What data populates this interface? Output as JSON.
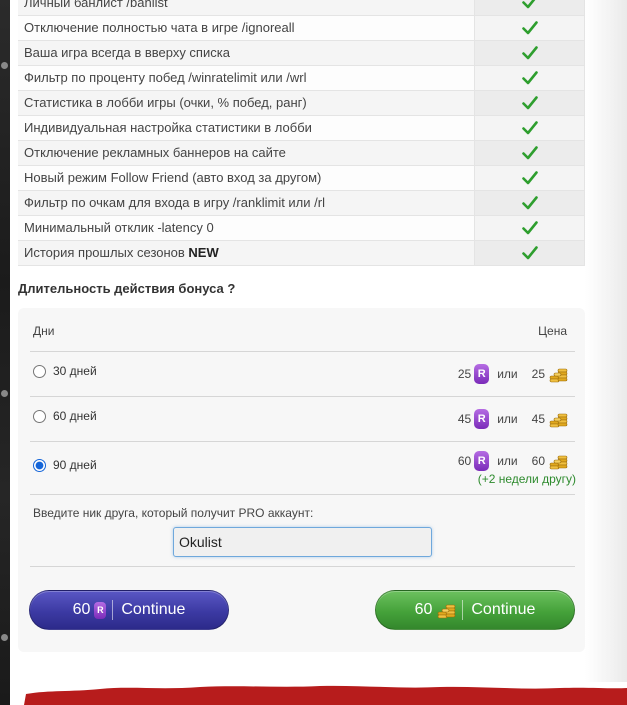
{
  "features": [
    {
      "label": "Личный банлист /banlist",
      "new": ""
    },
    {
      "label": "Отключение полностью чата в игре /ignoreall",
      "new": ""
    },
    {
      "label": "Ваша игра всегда в вверху списка",
      "new": ""
    },
    {
      "label": "Фильтр по проценту побед /winratelimit или /wrl",
      "new": ""
    },
    {
      "label": "Статистика в лобби игры (очки, % побед, ранг)",
      "new": ""
    },
    {
      "label": "Индивидуальная настройка статистики в лобби",
      "new": ""
    },
    {
      "label": "Отключение рекламных баннеров на сайте",
      "new": ""
    },
    {
      "label": "Новый режим Follow Friend (авто вход за другом)",
      "new": ""
    },
    {
      "label": "Фильтр по очкам для входа в игру /ranklimit или /rl",
      "new": ""
    },
    {
      "label": "Минимальный отклик -latency 0",
      "new": ""
    },
    {
      "label": "История прошлых сезонов ",
      "new": "NEW"
    }
  ],
  "duration_title": "Длительность действия бонуса ?",
  "header": {
    "days": "Дни",
    "price": "Цена"
  },
  "options": [
    {
      "label": "30 дней",
      "price_r": "25",
      "or": "или",
      "price_coin": "25",
      "selected": false
    },
    {
      "label": "60 дней",
      "price_r": "45",
      "or": "или",
      "price_coin": "45",
      "selected": false
    },
    {
      "label": "90 дней",
      "price_r": "60",
      "or": "или",
      "price_coin": "60",
      "selected": true
    }
  ],
  "bonus_note": "(+2 недели другу)",
  "friend": {
    "label": "Введите ник друга, который получит PRO аккаунт:",
    "value": "Okulist"
  },
  "buttons": {
    "purple": {
      "amount": "60",
      "label": "Continue"
    },
    "green": {
      "amount": "60",
      "label": "Continue"
    }
  },
  "colors": {
    "purple_button": "#3c3aa3",
    "green_button": "#45a23a",
    "check": "#2e9e2e",
    "bonus_text": "#2e8b2e"
  },
  "icons": {
    "check": "checkmark-icon",
    "r_currency": "r-currency-icon",
    "coins": "coin-stack-icon"
  }
}
